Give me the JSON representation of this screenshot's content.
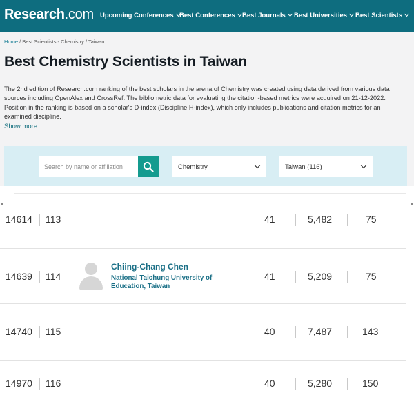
{
  "header": {
    "logo_main": "Research",
    "logo_suffix": ".com",
    "nav": [
      {
        "label": "Upcoming Conferences"
      },
      {
        "label": "Best Conferences"
      },
      {
        "label": "Best Journals"
      },
      {
        "label": "Best Universities"
      },
      {
        "label": "Best Scientists"
      }
    ]
  },
  "breadcrumb": {
    "home": "Home",
    "sep": " / ",
    "discipline": "Best Scientists - Chemistry",
    "sep2": " / ",
    "country": "Taiwan"
  },
  "page": {
    "title": "Best Chemistry Scientists in Taiwan",
    "description": "The 2nd edition of Research.com ranking of the best scholars in the arena of Chemistry was created using data derived from various data sources including OpenAlex and CrossRef. The bibliometric data for evaluating the citation-based metrics were acquired on 21-12-2022. Position in the ranking is based on a scholar's D-index (Discipline H-index), which only includes publications and citation metrics for an examined discipline.",
    "show_more": "Show more"
  },
  "filters": {
    "search_placeholder": "Search by name or affiliation",
    "discipline": "Chemistry",
    "country": "Taiwan (116)"
  },
  "rows": [
    {
      "world_rank": "14614",
      "national_rank": "113",
      "name": "",
      "institution": "",
      "d_index": "41",
      "citations": "5,482",
      "publications": "75"
    },
    {
      "world_rank": "14639",
      "national_rank": "114",
      "name": "Chiing-Chang Chen",
      "institution": "National Taichung University of Education, Taiwan",
      "d_index": "41",
      "citations": "5,209",
      "publications": "75"
    },
    {
      "world_rank": "14740",
      "national_rank": "115",
      "name": "",
      "institution": "",
      "d_index": "40",
      "citations": "7,487",
      "publications": "143"
    },
    {
      "world_rank": "14970",
      "national_rank": "116",
      "name": "",
      "institution": "",
      "d_index": "40",
      "citations": "5,280",
      "publications": "150"
    }
  ],
  "colors": {
    "header_bg": "#0e6d7f",
    "accent": "#149b8f",
    "link": "#1a6f86",
    "filter_bg": "#d8eef4"
  }
}
